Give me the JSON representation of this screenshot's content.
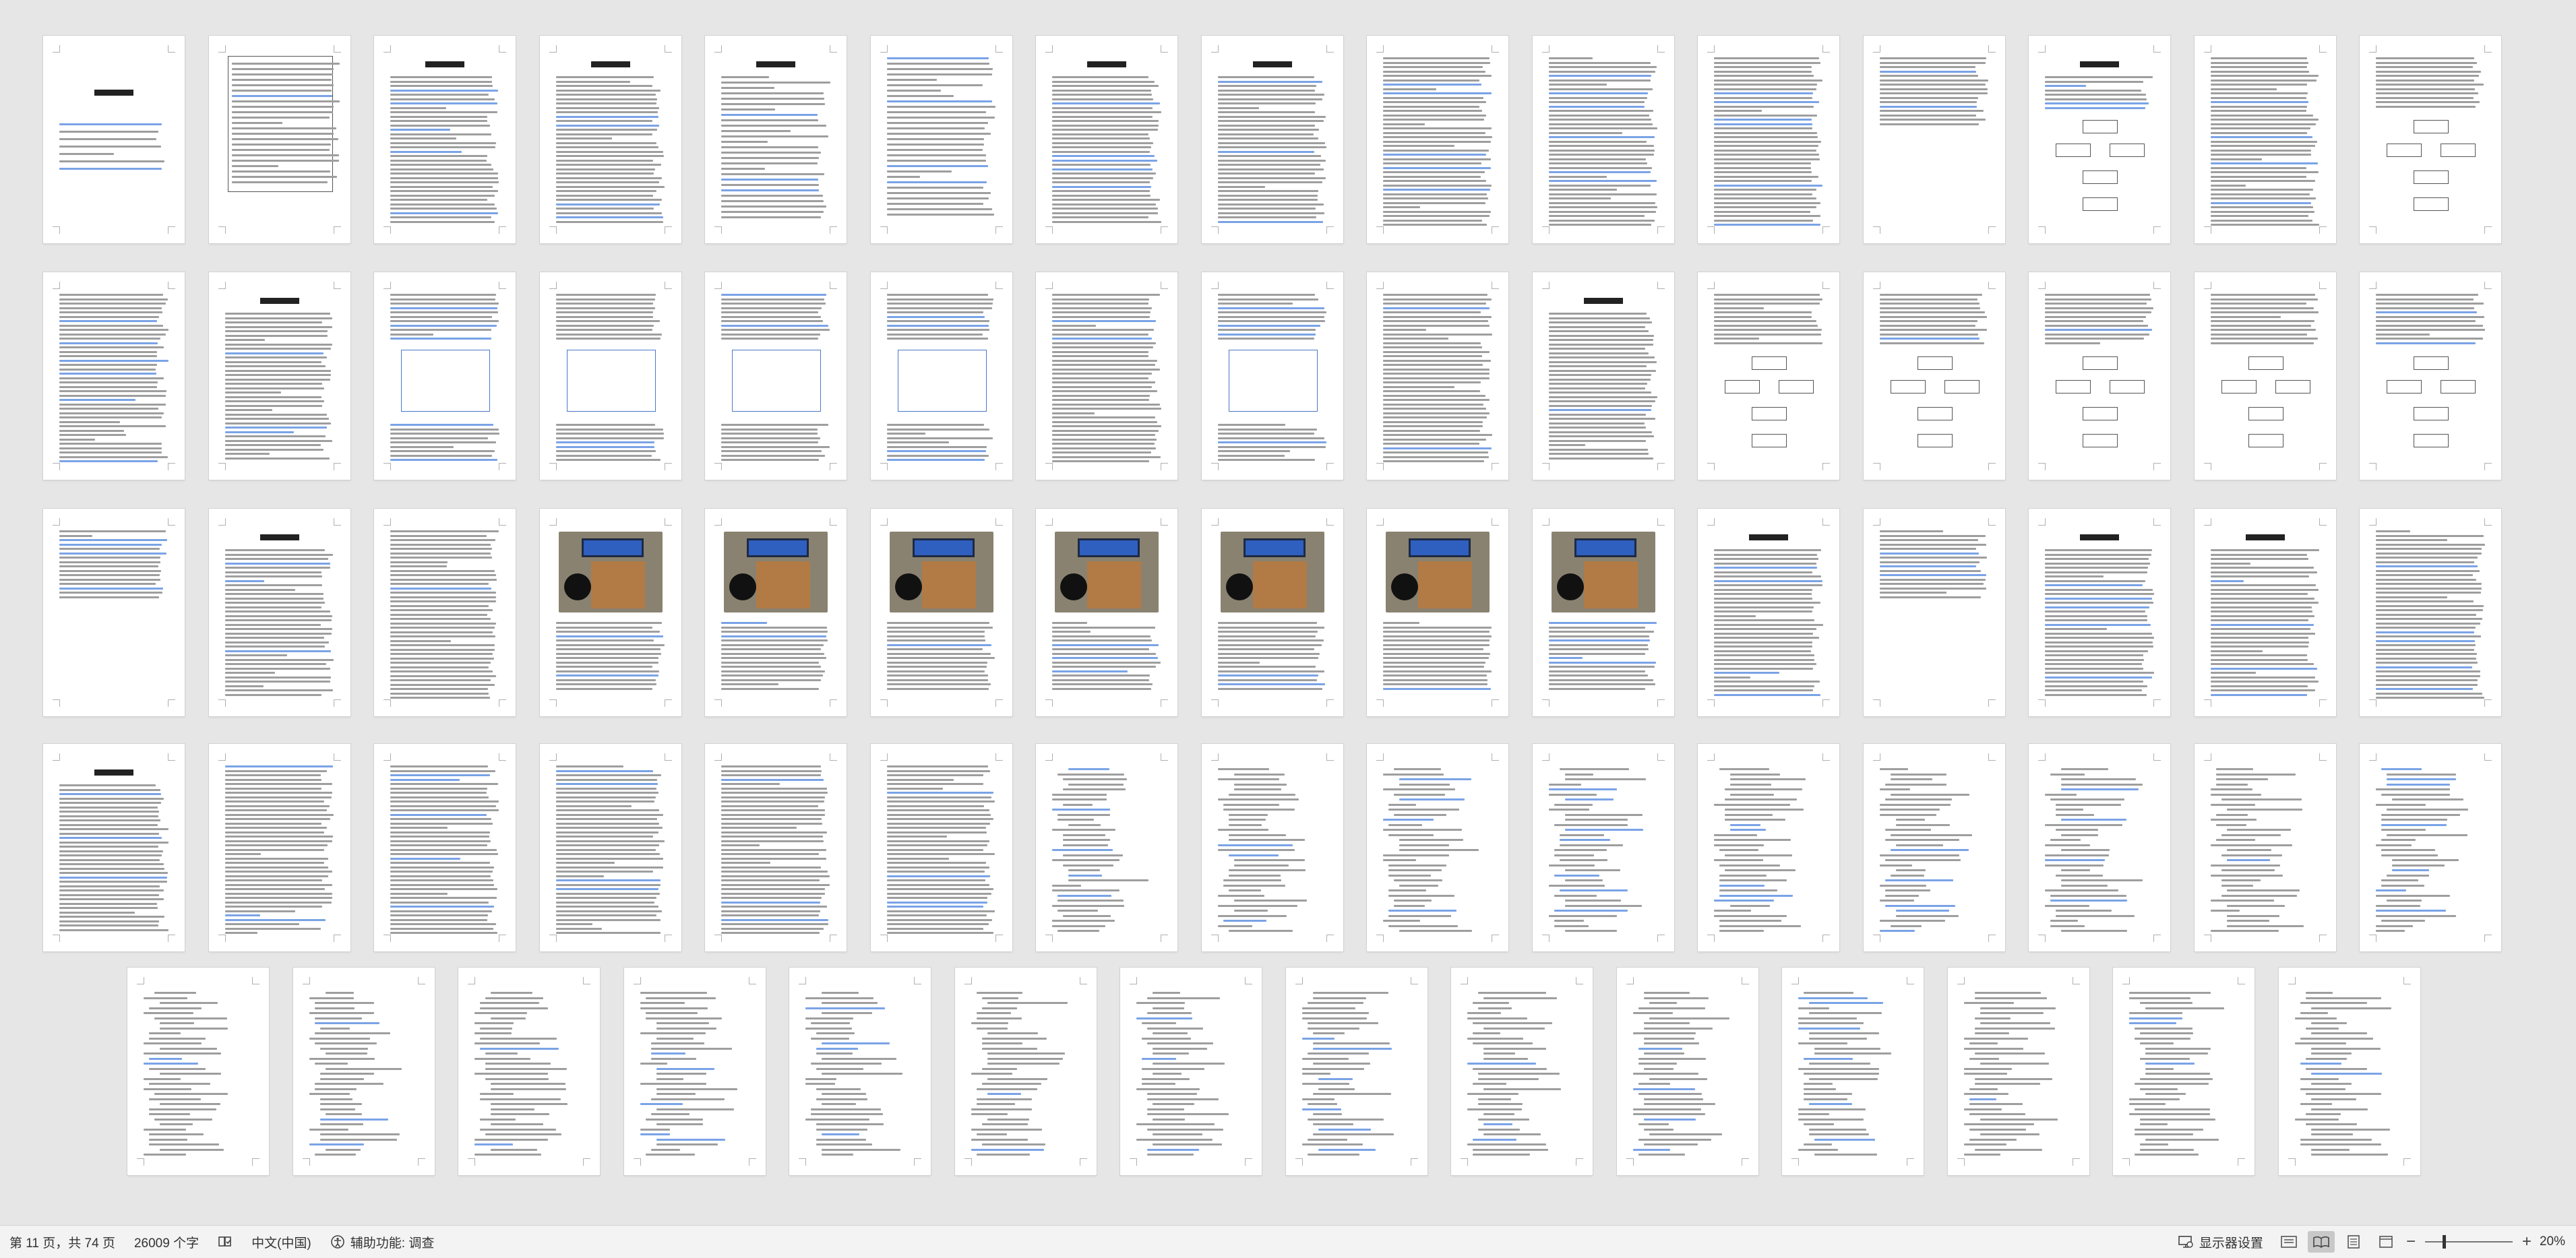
{
  "document": {
    "pages_shown": 74,
    "grid_columns": 15
  },
  "statusbar": {
    "page_info": "第 11 页，共 74 页",
    "word_count": "26009 个字",
    "proof_icon": "proofing-book-icon",
    "language": "中文(中国)",
    "accessibility": "辅助功能: 调查",
    "display_settings": "显示器设置",
    "zoom_minus": "−",
    "zoom_plus": "+",
    "zoom_level": "20%",
    "zoom_fraction": 0.2
  },
  "pages": [
    {
      "kind": "cover"
    },
    {
      "kind": "form"
    },
    {
      "kind": "text",
      "title": "摘 要"
    },
    {
      "kind": "text",
      "title": "ABSTRACT"
    },
    {
      "kind": "toc",
      "title": "目 录"
    },
    {
      "kind": "toc"
    },
    {
      "kind": "text",
      "title": "目 录"
    },
    {
      "kind": "text",
      "title": "第一章 绪论"
    },
    {
      "kind": "text"
    },
    {
      "kind": "text"
    },
    {
      "kind": "text"
    },
    {
      "kind": "short"
    },
    {
      "kind": "diagram",
      "title": "第二章 电子密码锁的设计方案"
    },
    {
      "kind": "text"
    },
    {
      "kind": "diagram"
    },
    {
      "kind": "text"
    },
    {
      "kind": "text",
      "title": "第三章 电子密码锁的硬件设计"
    },
    {
      "kind": "circuit"
    },
    {
      "kind": "circuit"
    },
    {
      "kind": "circuit"
    },
    {
      "kind": "circuit"
    },
    {
      "kind": "text"
    },
    {
      "kind": "circuit"
    },
    {
      "kind": "text"
    },
    {
      "kind": "text",
      "title": "第四章 系统的软件设计"
    },
    {
      "kind": "diagram"
    },
    {
      "kind": "diagram"
    },
    {
      "kind": "diagram"
    },
    {
      "kind": "diagram"
    },
    {
      "kind": "diagram"
    },
    {
      "kind": "short"
    },
    {
      "kind": "text",
      "title": "第五章 实物制作与调试"
    },
    {
      "kind": "text"
    },
    {
      "kind": "photo"
    },
    {
      "kind": "photo"
    },
    {
      "kind": "photo"
    },
    {
      "kind": "photo"
    },
    {
      "kind": "photo"
    },
    {
      "kind": "photo"
    },
    {
      "kind": "photo"
    },
    {
      "kind": "text",
      "title": "结 论"
    },
    {
      "kind": "short"
    },
    {
      "kind": "text",
      "title": "致 谢"
    },
    {
      "kind": "text",
      "title": "参考文献"
    },
    {
      "kind": "text"
    },
    {
      "kind": "text",
      "title": "附 录"
    },
    {
      "kind": "text"
    },
    {
      "kind": "text"
    },
    {
      "kind": "text"
    },
    {
      "kind": "text"
    },
    {
      "kind": "text"
    },
    {
      "kind": "code"
    },
    {
      "kind": "code"
    },
    {
      "kind": "code"
    },
    {
      "kind": "code"
    },
    {
      "kind": "code"
    },
    {
      "kind": "code"
    },
    {
      "kind": "code"
    },
    {
      "kind": "code"
    },
    {
      "kind": "code"
    },
    {
      "kind": "code"
    },
    {
      "kind": "code"
    },
    {
      "kind": "code"
    },
    {
      "kind": "code"
    },
    {
      "kind": "code"
    },
    {
      "kind": "code"
    },
    {
      "kind": "code"
    },
    {
      "kind": "code"
    },
    {
      "kind": "code"
    },
    {
      "kind": "code"
    },
    {
      "kind": "code"
    },
    {
      "kind": "code"
    },
    {
      "kind": "code"
    },
    {
      "kind": "code"
    }
  ]
}
